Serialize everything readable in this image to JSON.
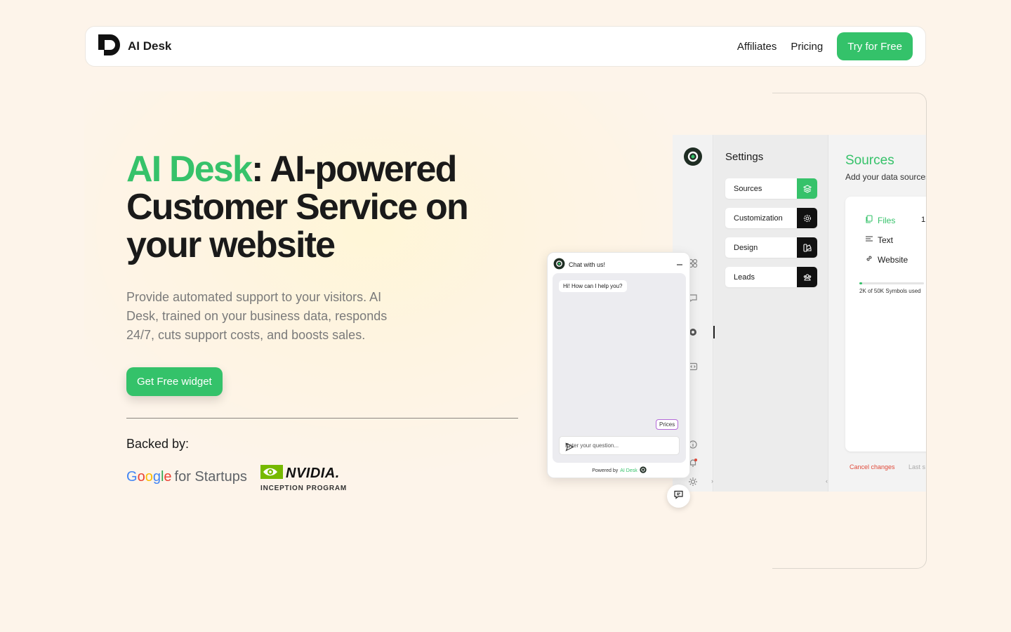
{
  "brand": {
    "name": "AI Desk"
  },
  "nav": {
    "links": [
      "Affiliates",
      "Pricing"
    ],
    "cta": "Try for Free"
  },
  "hero": {
    "title_accent": "AI Desk",
    "title_rest": ": AI-powered Customer Service on your website",
    "subtitle": "Provide automated support to your visitors. AI Desk, trained on your business data, responds 24/7, cuts support costs, and boosts sales.",
    "cta": "Get Free widget"
  },
  "backed": {
    "label": "Backed by:",
    "google_word": "Google",
    "google_suffix": "for Startups",
    "nvidia_word": "NVIDIA.",
    "nvidia_sub": "INCEPTION PROGRAM"
  },
  "app": {
    "settings_title": "Settings",
    "settings_items": [
      "Sources",
      "Customization",
      "Design",
      "Leads"
    ],
    "sources_title": "Sources",
    "sources_sub": "Add your data sources",
    "source_types": [
      "Files",
      "Text",
      "Website"
    ],
    "files_count": "1",
    "usage_text": "2K of 50K Symbols used",
    "usage_fraction": 0.04,
    "cancel_label": "Cancel changes",
    "last_saved": "Last s"
  },
  "chat": {
    "header": "Chat with us!",
    "greeting": "Hi! How can I help you?",
    "chip": "Prices",
    "input_placeholder": "Enter your question...",
    "powered_prefix": "Powered by",
    "powered_brand": "AI Desk"
  },
  "colors": {
    "accent": "#36c26a",
    "background": "#fdf4ea",
    "danger": "#e04a3a"
  }
}
